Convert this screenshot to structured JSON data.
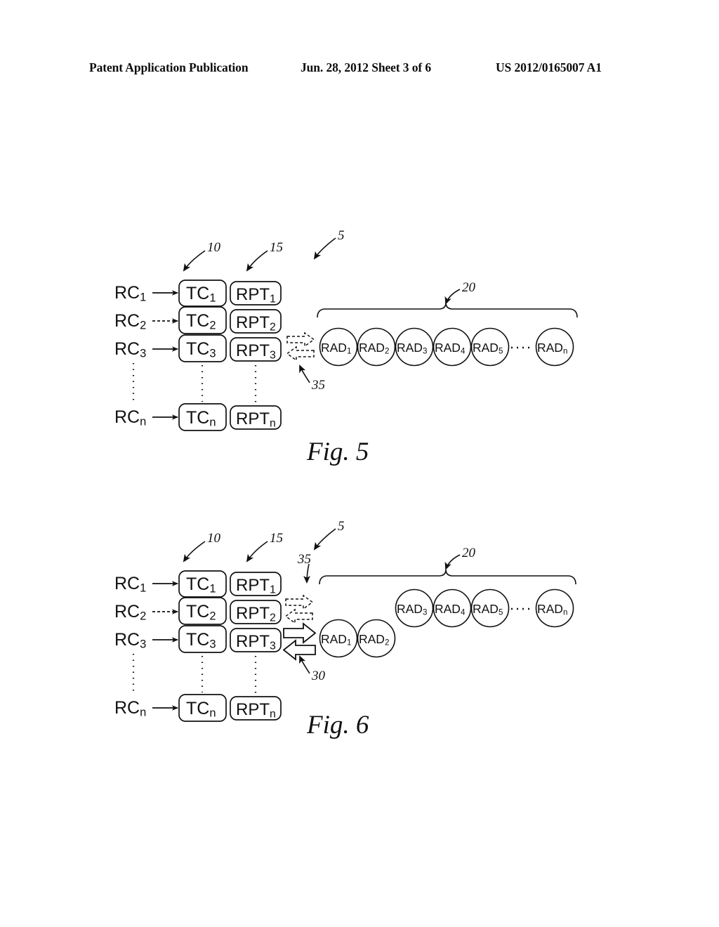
{
  "header": {
    "left": "Patent Application Publication",
    "middle": "Jun. 28, 2012  Sheet 3 of 6",
    "right": "US 2012/0165007 A1"
  },
  "figures": [
    {
      "caption": "Fig. 5",
      "reference_numerals": [
        "10",
        "15",
        "5",
        "20",
        "35"
      ],
      "request_channels": [
        {
          "label": "RC",
          "sub": "1"
        },
        {
          "label": "RC",
          "sub": "2"
        },
        {
          "label": "RC",
          "sub": "3"
        },
        {
          "label": "RC",
          "sub": "n"
        }
      ],
      "task_contexts": [
        {
          "label": "TC",
          "sub": "1"
        },
        {
          "label": "TC",
          "sub": "2"
        },
        {
          "label": "TC",
          "sub": "3"
        },
        {
          "label": "TC",
          "sub": "n"
        }
      ],
      "repeat_tokens": [
        {
          "label": "RPT",
          "sub": "1"
        },
        {
          "label": "RPT",
          "sub": "2"
        },
        {
          "label": "RPT",
          "sub": "3"
        },
        {
          "label": "RPT",
          "sub": "n"
        }
      ],
      "rad_units_grouped": [
        {
          "label": "RAD",
          "sub": "1"
        },
        {
          "label": "RAD",
          "sub": "2"
        },
        {
          "label": "RAD",
          "sub": "3"
        },
        {
          "label": "RAD",
          "sub": "4"
        },
        {
          "label": "RAD",
          "sub": "5"
        },
        {
          "label": "RAD",
          "sub": "n"
        }
      ],
      "rad_units_detached": [],
      "ellipsis": "......"
    },
    {
      "caption": "Fig. 6",
      "reference_numerals": [
        "10",
        "15",
        "5",
        "35",
        "20",
        "30"
      ],
      "request_channels": [
        {
          "label": "RC",
          "sub": "1"
        },
        {
          "label": "RC",
          "sub": "2"
        },
        {
          "label": "RC",
          "sub": "3"
        },
        {
          "label": "RC",
          "sub": "n"
        }
      ],
      "task_contexts": [
        {
          "label": "TC",
          "sub": "1"
        },
        {
          "label": "TC",
          "sub": "2"
        },
        {
          "label": "TC",
          "sub": "3"
        },
        {
          "label": "TC",
          "sub": "n"
        }
      ],
      "repeat_tokens": [
        {
          "label": "RPT",
          "sub": "1"
        },
        {
          "label": "RPT",
          "sub": "2"
        },
        {
          "label": "RPT",
          "sub": "3"
        },
        {
          "label": "RPT",
          "sub": "n"
        }
      ],
      "rad_units_grouped": [
        {
          "label": "RAD",
          "sub": "3"
        },
        {
          "label": "RAD",
          "sub": "4"
        },
        {
          "label": "RAD",
          "sub": "5"
        },
        {
          "label": "RAD",
          "sub": "n"
        }
      ],
      "rad_units_detached": [
        {
          "label": "RAD",
          "sub": "1"
        },
        {
          "label": "RAD",
          "sub": "2"
        }
      ],
      "ellipsis": "......"
    }
  ]
}
